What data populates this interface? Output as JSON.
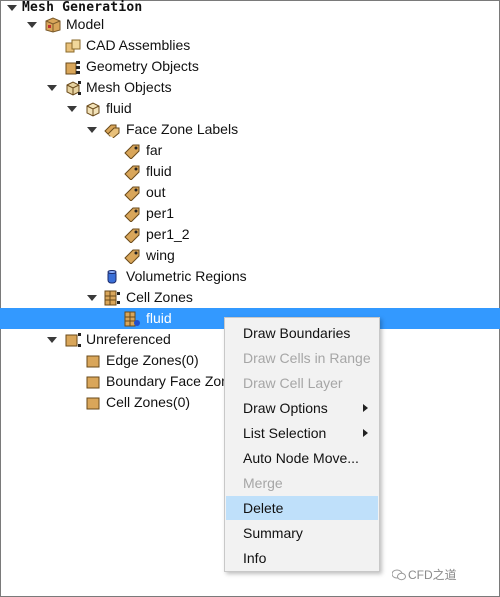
{
  "tree": {
    "root": "Mesh Generation",
    "model": "Model",
    "cad_assemblies": "CAD Assemblies",
    "geometry_objects": "Geometry Objects",
    "mesh_objects": "Mesh Objects",
    "fluid_object": "fluid",
    "face_zone_labels": "Face Zone Labels",
    "labels": [
      "far",
      "fluid",
      "out",
      "per1",
      "per1_2",
      "wing"
    ],
    "volumetric_regions": "Volumetric Regions",
    "cell_zones": "Cell Zones",
    "cell_zone_fluid": "fluid",
    "unreferenced": "Unreferenced",
    "edge_zones": "Edge Zones(0)",
    "boundary_face_zones": "Boundary Face Zon",
    "cell_zones_count": "Cell Zones(0)"
  },
  "context_menu": {
    "items": [
      {
        "label": "Draw Boundaries",
        "enabled": true
      },
      {
        "label": "Draw Cells in Range",
        "enabled": false
      },
      {
        "label": "Draw Cell Layer",
        "enabled": false
      },
      {
        "label": "Draw Options",
        "enabled": true,
        "submenu": true
      },
      {
        "label": "List Selection",
        "enabled": true,
        "submenu": true
      },
      {
        "label": "Auto Node Move...",
        "enabled": true
      },
      {
        "label": "Merge",
        "enabled": false
      },
      {
        "label": "Delete",
        "enabled": true,
        "highlighted": true
      },
      {
        "label": "Summary",
        "enabled": true
      },
      {
        "label": "Info",
        "enabled": true
      }
    ]
  },
  "watermark": "CFD之道",
  "colors": {
    "selection": "#3399ff",
    "menu_highlight": "#bfe0fa",
    "disabled_text": "#a6a6a6"
  }
}
